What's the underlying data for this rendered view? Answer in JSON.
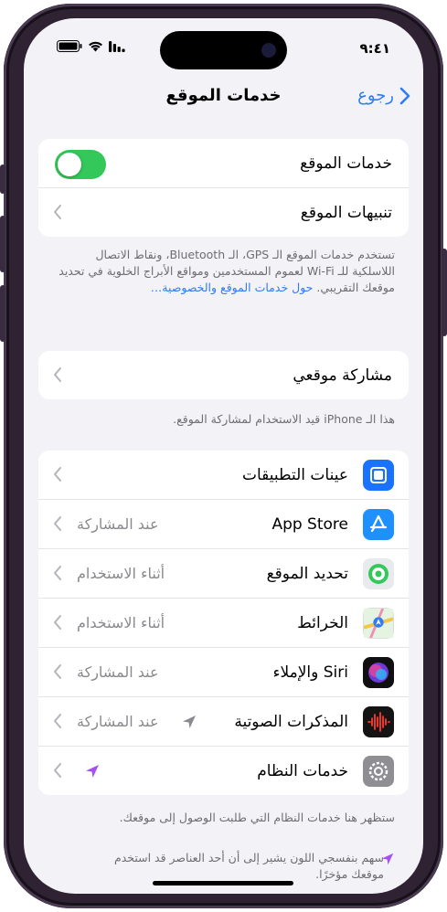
{
  "status": {
    "time": "٩:٤١"
  },
  "nav": {
    "title": "خدمات الموقع",
    "back_label": "رجوع"
  },
  "main_group": {
    "location_services_label": "خدمات الموقع",
    "location_services_on": true,
    "location_alerts_label": "تنبيهات الموقع"
  },
  "info": {
    "description": "تستخدم خدمات الموقع الـ GPS، الـ Bluetooth، ونقاط الاتصال اللاسلكية للـ Wi-Fi لعموم المستخدمين ومواقع الأبراج الخلوية في تحديد موقعك التقريبي.",
    "link": "حول خدمات الموقع والخصوصية…"
  },
  "sharing": {
    "label": "مشاركة موقعي",
    "note": "هذا الـ iPhone قيد الاستخدام لمشاركة الموقع."
  },
  "apps": [
    {
      "label": "عينات التطبيقات",
      "value": ""
    },
    {
      "label": "App Store",
      "value": "عند المشاركة"
    },
    {
      "label": "تحديد الموقع",
      "value": "أثناء الاستخدام"
    },
    {
      "label": "الخرائط",
      "value": "أثناء الاستخدام"
    },
    {
      "label": "Siri والإملاء",
      "value": "عند المشاركة"
    },
    {
      "label": "المذكرات الصوتية",
      "value": "عند المشاركة"
    },
    {
      "label": "خدمات النظام",
      "value": ""
    }
  ],
  "footer": {
    "system_note": "ستظهر هنا خدمات النظام التي طلبت الوصول إلى موقعك.",
    "arrow_note": "سهم بنفسجي اللون يشير إلى أن أحد العناصر قد استخدم موقعك مؤخرًا."
  },
  "colors": {
    "accent": "#2f7cf6",
    "toggle_on": "#34c759",
    "recent_arrow": "#a550f0",
    "arrow_gray": "#8a8a8e"
  }
}
